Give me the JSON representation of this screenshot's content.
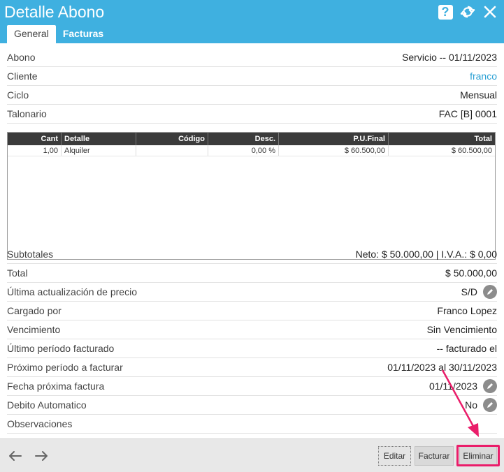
{
  "window": {
    "title": "Detalle Abono",
    "icons": [
      "help-icon",
      "refresh-icon",
      "close-icon"
    ],
    "accent_color": "#3fb0e0"
  },
  "tabs": [
    {
      "label": "General",
      "active": true
    },
    {
      "label": "Facturas",
      "active": false
    }
  ],
  "fields_top": [
    {
      "label": "Abono",
      "value": "Servicio -- 01/11/2023"
    },
    {
      "label": "Cliente",
      "value": "franco"
    },
    {
      "label": "Ciclo",
      "value": "Mensual"
    },
    {
      "label": "Talonario",
      "value": "FAC [B] 0001"
    }
  ],
  "items_table": {
    "headers": [
      "Cant",
      "Detalle",
      "Código",
      "Desc.",
      "P.U.Final",
      "Total"
    ],
    "rows": [
      [
        "1,00",
        "Alquiler",
        "",
        "0,00 %",
        "$ 60.500,00",
        "$ 60.500,00"
      ]
    ]
  },
  "fields_bottom": [
    {
      "label": "Subtotales",
      "value": "Neto: $ 50.000,00 | I.V.A.: $ 0,00"
    },
    {
      "label": "Total",
      "value": "$ 50.000,00"
    },
    {
      "label": "Última actualización de precio",
      "value": "S/D"
    },
    {
      "label": "Cargado por",
      "value": "Franco Lopez"
    },
    {
      "label": "Vencimiento",
      "value": "Sin Vencimiento"
    },
    {
      "label": "Último período facturado",
      "value": "-- facturado el"
    },
    {
      "label": "Próximo período a facturar",
      "value": "01/11/2023 al 30/11/2023"
    },
    {
      "label": "Fecha próxima factura",
      "value": "01/11/2023"
    },
    {
      "label": "Debito Automatico",
      "value": "No"
    },
    {
      "label": "Observaciones",
      "value": ""
    }
  ],
  "footer": {
    "buttons": {
      "edit": "Editar",
      "invoice": "Facturar",
      "delete": "Eliminar"
    },
    "highlight_color": "#ea1d6a"
  }
}
